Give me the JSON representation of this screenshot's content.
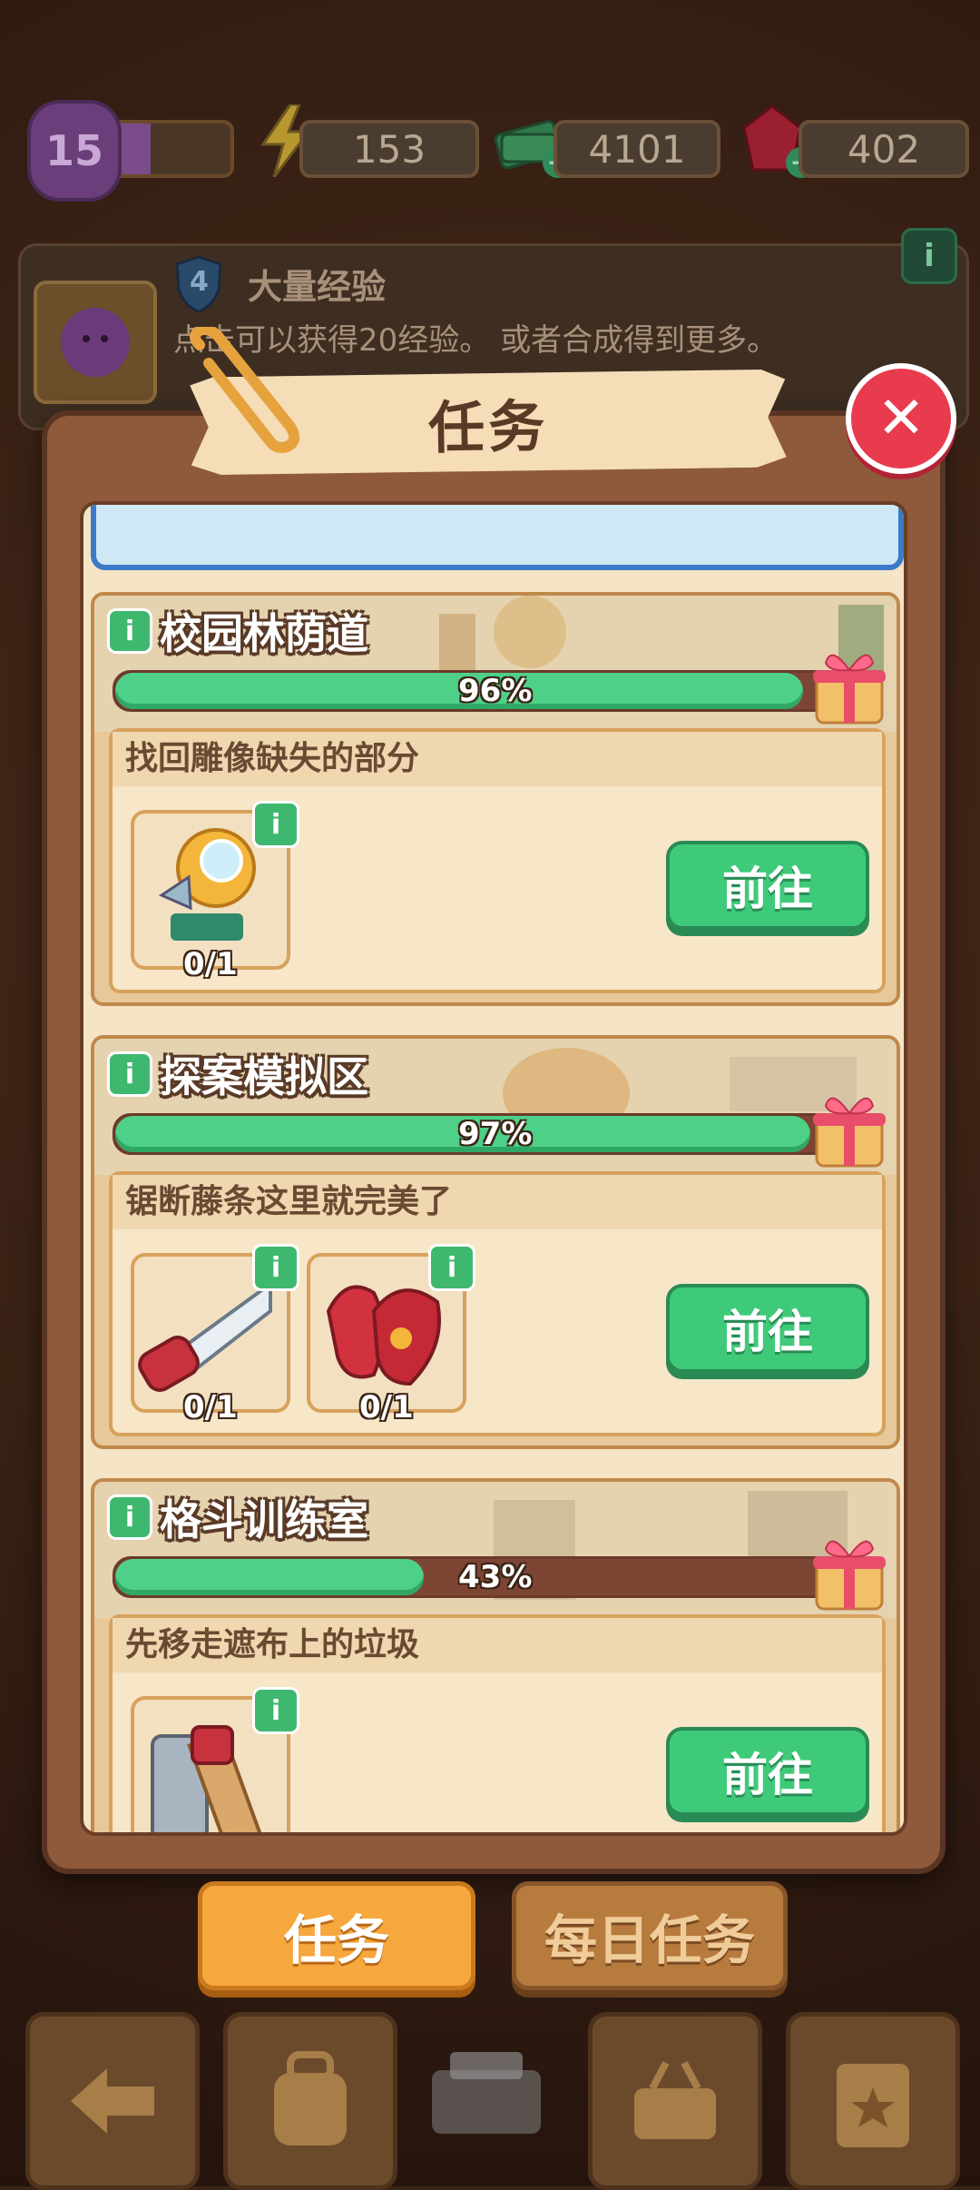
{
  "topbar": {
    "level": "15",
    "energy": "153",
    "cash": "4101",
    "gems": "402",
    "icons": [
      "purple-cog-icon",
      "lightning-icon",
      "cash-stack-icon",
      "red-gem-icon"
    ]
  },
  "info_strip": {
    "shield_number": "4",
    "title": "大量经验",
    "description": "点击可以获得20经验。 或者合成得到更多。"
  },
  "dialog": {
    "title": "任务",
    "close_icon": "close-icon"
  },
  "tasks": [
    {
      "name": "校园林荫道",
      "progress_label": "96%",
      "progress_value": 0.96,
      "description": "找回雕像缺失的部分",
      "items": [
        {
          "count": "0/1",
          "icon": "magnifier-lamp-icon"
        }
      ],
      "go_label": "前往"
    },
    {
      "name": "探案模拟区",
      "progress_label": "97%",
      "progress_value": 0.97,
      "description": "锯断藤条这里就完美了",
      "items": [
        {
          "count": "0/1",
          "icon": "hand-saw-icon"
        },
        {
          "count": "0/1",
          "icon": "red-gloves-icon"
        }
      ],
      "go_label": "前往"
    },
    {
      "name": "格斗训练室",
      "progress_label": "43%",
      "progress_value": 0.43,
      "description": "先移走遮布上的垃圾",
      "items": [
        {
          "count": "",
          "icon": "wrench-tool-icon"
        }
      ],
      "go_label": "前往"
    }
  ],
  "tabs": {
    "tasks": "任务",
    "daily_tasks": "每日任务"
  },
  "colors": {
    "progress_fill": "#4fd088",
    "go_button": "#3fca7a",
    "close_button": "#e83b4d",
    "active_tab": "#f6a73e"
  }
}
